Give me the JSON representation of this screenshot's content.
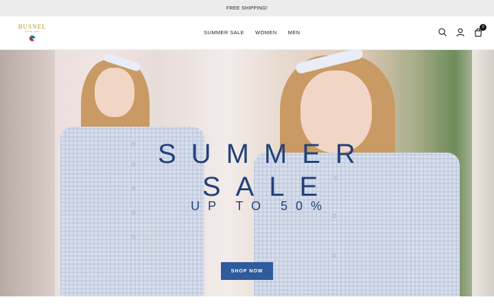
{
  "announcement": {
    "text": "FREE SHIPPING!"
  },
  "header": {
    "logo": {
      "word": "BUSNEL",
      "tagline": "SINCE 1947"
    },
    "nav": [
      {
        "label": "SUMMER SALE"
      },
      {
        "label": "WOMEN"
      },
      {
        "label": "MEN"
      }
    ],
    "icons": [
      "search-icon",
      "account-icon",
      "cart-icon"
    ],
    "cart_count": "0"
  },
  "hero": {
    "title_line1": "SUMMER",
    "title_line2": "SALE",
    "subtitle": "UP TO 50%",
    "cta_label": "SHOP NOW"
  },
  "colors": {
    "announcement_bg": "#ececec",
    "hero_text": "#23417a",
    "cta_bg": "#2f5b9c",
    "logo_gold": "#b8962e"
  }
}
